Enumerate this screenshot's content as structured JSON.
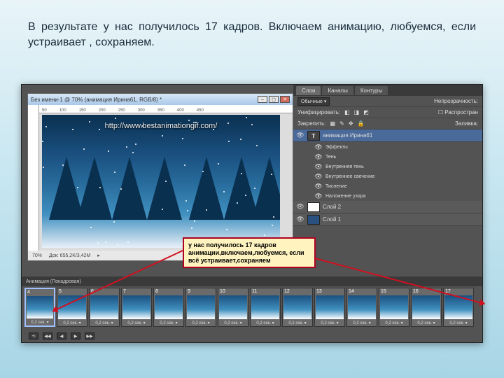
{
  "caption": "В результате у нас получилось 17 кадров. Включаем анимацию, любуемся, если устраивает , сохраняем.",
  "doc": {
    "title": "Без имени-1 @ 70% (анимация Ирина61, RGB/8) *",
    "ruler": [
      "50",
      "100",
      "150",
      "200",
      "250",
      "300",
      "350",
      "400",
      "450"
    ],
    "watermark_url": "http://www.bestanimationgif.com/",
    "status_zoom": "70%",
    "status_doc": "Док: 655,2K/3,42M"
  },
  "note": "у нас получилось 17 кадров анимации,включаем,любуемся, если всё устраивает,сохраняем",
  "panels": {
    "tabs": [
      "Слои",
      "Каналы",
      "Контуры"
    ],
    "blend_label": "Обычные",
    "opacity_label": "Непрозрачность:",
    "fill_prefix": "Заливка:",
    "lock_label": "Закрепить:",
    "unified": "Унифицировать:",
    "spread_cb": "Распростран",
    "layer_text": {
      "marker": "T",
      "name": "анимация Ирина61"
    },
    "fx_header": "Эффекты",
    "fx": [
      "Тень",
      "Внутренняя тень",
      "Внутреннее свечение",
      "Тиснение",
      "Наложение узора"
    ],
    "layer2": "Слой 2",
    "layer1": "Слой 1"
  },
  "timeline": {
    "header": "Анимация (Покадровая)",
    "frames": [
      {
        "n": "4",
        "t": "0,2 сек."
      },
      {
        "n": "5",
        "t": "0,2 сек."
      },
      {
        "n": "6",
        "t": "0,2 сек."
      },
      {
        "n": "7",
        "t": "0,2 сек."
      },
      {
        "n": "8",
        "t": "0,2 сек."
      },
      {
        "n": "9",
        "t": "0,2 сек."
      },
      {
        "n": "10",
        "t": "0,2 сек."
      },
      {
        "n": "11",
        "t": "0,2 сек."
      },
      {
        "n": "12",
        "t": "0,2 сек."
      },
      {
        "n": "13",
        "t": "0,2 сек."
      },
      {
        "n": "14",
        "t": "0,2 сек."
      },
      {
        "n": "15",
        "t": "0,2 сек."
      },
      {
        "n": "16",
        "t": "0,2 сек."
      },
      {
        "n": "17",
        "t": "0,2 сек."
      }
    ],
    "controls": [
      "⟲",
      "◀◀",
      "◀",
      "▶",
      "▶▶"
    ]
  }
}
